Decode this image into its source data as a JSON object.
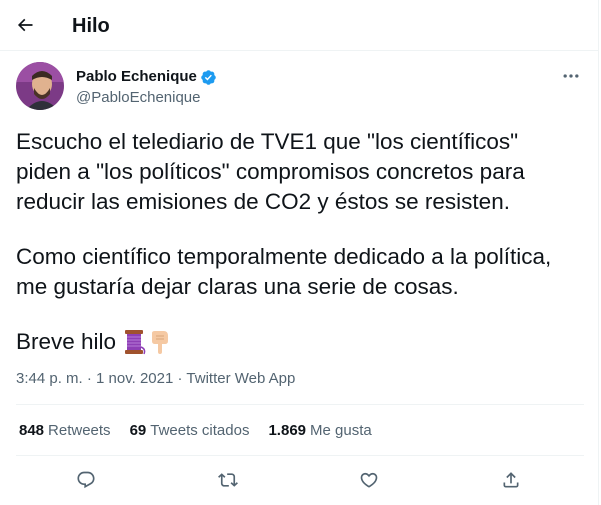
{
  "header": {
    "title": "Hilo",
    "back_icon": "arrow-left-icon"
  },
  "tweet": {
    "author": {
      "name": "Pablo Echenique",
      "handle": "@PabloEchenique",
      "verified_icon": "verified-badge-icon"
    },
    "paragraphs": [
      [
        "Escucho el telediario de TVE1 que \"los científicos\"",
        "piden a \"los políticos\" compromisos concretos para",
        "reducir las emisiones de CO2 y éstos se resisten."
      ],
      [
        "Como científico temporalmente dedicado a la política,",
        "me gustaría dejar claras una serie de cosas."
      ]
    ],
    "closing": "Breve hilo",
    "closing_emoji_icons": [
      "thread-spool-emoji",
      "pointing-down-hand-emoji"
    ],
    "time": "3:44 p. m.",
    "separator": "·",
    "date": "1 nov. 2021",
    "source": "Twitter Web App"
  },
  "stats": [
    {
      "value": "848",
      "label": "Retweets"
    },
    {
      "value": "69",
      "label": "Tweets citados"
    },
    {
      "value": "1.869",
      "label": "Me gusta"
    }
  ],
  "actions": [
    "reply-icon",
    "retweet-icon",
    "like-icon",
    "share-icon"
  ],
  "colors": {
    "text": "#0f1419",
    "secondary": "#536471",
    "border": "#eff3f4",
    "verified": "#1d9bf0"
  }
}
